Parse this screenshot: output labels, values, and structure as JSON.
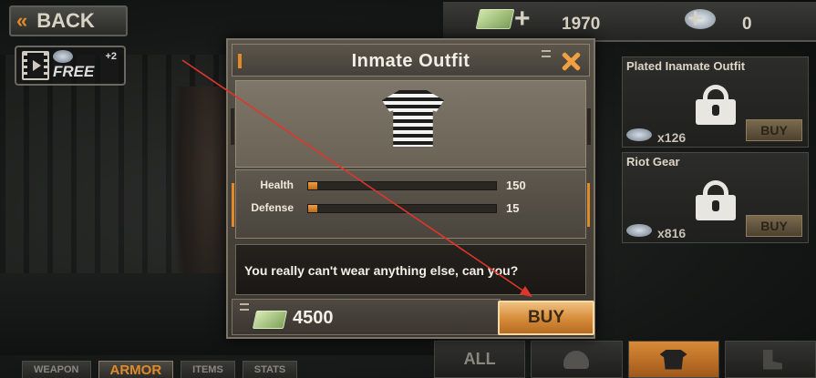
{
  "header": {
    "back_label": "BACK",
    "free_label": "FREE",
    "free_bonus": "+2"
  },
  "currency": {
    "cash": "1970",
    "gems": "0"
  },
  "items": [
    {
      "title": "Plated Inamate Outfit",
      "price": "x126",
      "buy_label": "BUY"
    },
    {
      "title": "Riot Gear",
      "price": "x816",
      "buy_label": "BUY"
    }
  ],
  "modal": {
    "title": "Inmate Outfit",
    "stats": [
      {
        "label": "Health",
        "value": "150",
        "fill": 0.05
      },
      {
        "label": "Defense",
        "value": "15",
        "fill": 0.05
      }
    ],
    "description": "You really can't wear anything else, can you?",
    "price": "4500",
    "buy_label": "BUY"
  },
  "bottom_tabs": [
    "WEAPON",
    "ARMOR",
    "ITEMS",
    "STATS"
  ],
  "active_tab": "ARMOR",
  "filter": {
    "all_label": "ALL"
  },
  "colors": {
    "accent_orange": "#e08a2a",
    "annotation_red": "#e0352b"
  },
  "icons": [
    "back-chevrons-icon",
    "video-icon",
    "cash-icon",
    "gem-icon",
    "plus-icon",
    "close-icon",
    "shirt-icon",
    "lock-icon",
    "helmet-icon",
    "boot-icon"
  ]
}
